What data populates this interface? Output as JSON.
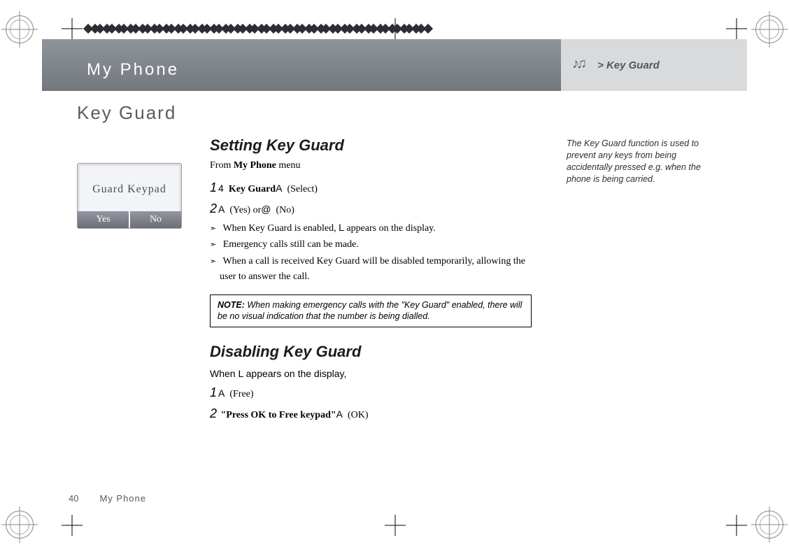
{
  "header": {
    "left_title": "My Phone",
    "breadcrumb_prefix": "> ",
    "breadcrumb_label": "Key Guard"
  },
  "section_title": "Key Guard",
  "setting": {
    "heading": "Setting Key Guard",
    "from_prefix": "From ",
    "from_menu": "My Phone",
    "from_suffix": " menu",
    "step1_num": "1",
    "step1_sym": "4",
    "step1_bold": "Key Guard",
    "step1_sym2": "A",
    "step1_paren": "(Select)",
    "step2_num": "2",
    "step2_sym": "A",
    "step2_paren1": "(Yes)",
    "step2_or": " or",
    "step2_sym2": "@",
    "step2_paren2": "(No)",
    "bullets": [
      {
        "pre": "When Key Guard is enabled, ",
        "sym": "L",
        "post": " appears on the display."
      },
      {
        "pre": "Emergency calls still can be made.",
        "sym": "",
        "post": ""
      },
      {
        "pre": "When a call is received Key Guard will be disabled temporarily, allowing the user to answer the call.",
        "sym": "",
        "post": ""
      }
    ],
    "note_label": "NOTE:",
    "note_text": " When making emergency calls with the \"Key Guard\" enabled, there will be no visual indication that the number is being dialled."
  },
  "disabling": {
    "heading": "Disabling Key Guard",
    "when_pre": "When",
    "when_sym": " L ",
    "when_post": "appears on the display,",
    "step1_num": "1",
    "step1_sym": "A",
    "step1_paren": "(Free)",
    "step2_num": "2",
    "step2_quote": "\"Press OK to Free keypad\"",
    "step2_sym": "A",
    "step2_paren": "(OK)"
  },
  "phone_mock": {
    "title": "Guard Keypad",
    "softkeys": {
      "left": "Yes",
      "right": "No"
    }
  },
  "sidenote": "The Key Guard function is used to prevent any keys from being accidentally pressed e.g. when the phone is being carried.",
  "footer": {
    "page_number": "40",
    "section": "My Phone"
  }
}
